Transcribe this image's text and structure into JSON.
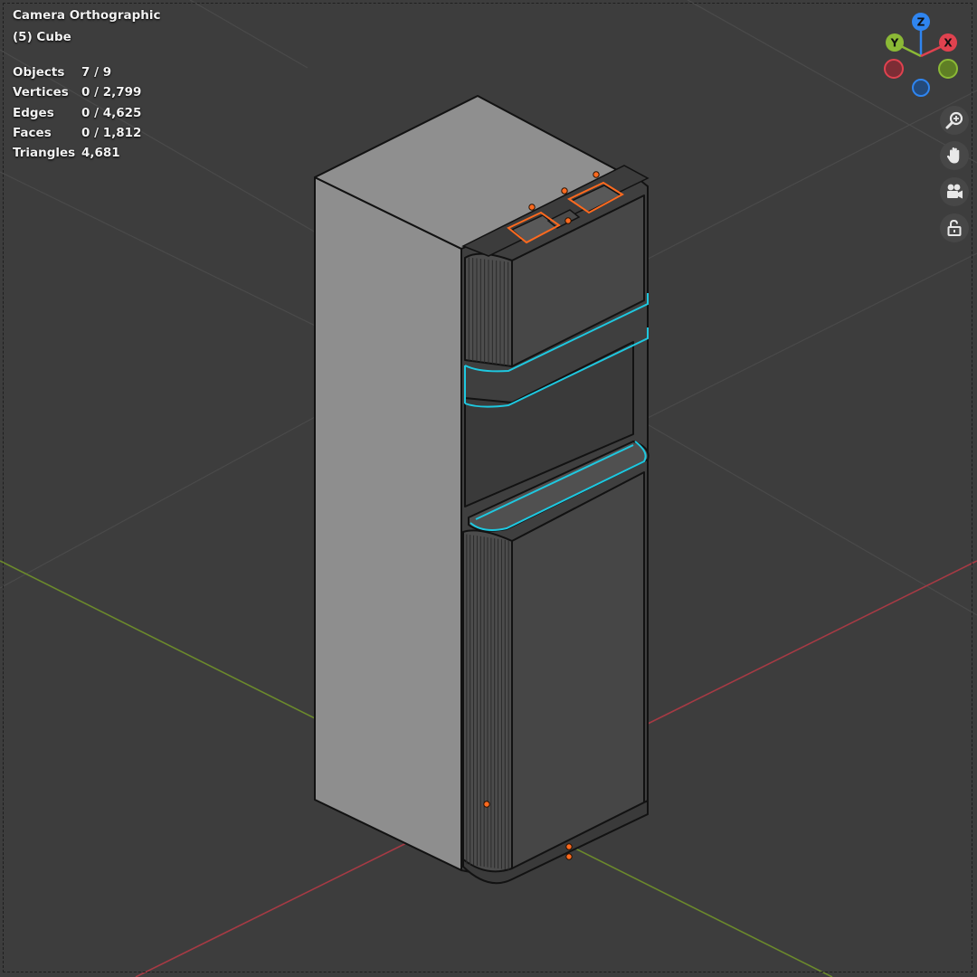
{
  "viewport": {
    "camera_title": "Camera Orthographic",
    "active_object": "(5) Cube",
    "stats": [
      {
        "label": "Objects",
        "value": "7 / 9"
      },
      {
        "label": "Vertices",
        "value": "0 / 2,799"
      },
      {
        "label": "Edges",
        "value": "0 / 4,625"
      },
      {
        "label": "Faces",
        "value": "0 / 1,812"
      },
      {
        "label": "Triangles",
        "value": "4,681"
      }
    ]
  },
  "gizmo": {
    "z_label": "Z",
    "y_label": "Y",
    "x_label": "X",
    "colors": {
      "x": "#e0424f",
      "y": "#8bb936",
      "z": "#2f85f0"
    }
  },
  "nav_buttons": [
    {
      "icon": "zoom-icon"
    },
    {
      "icon": "hand-pan-icon"
    },
    {
      "icon": "camera-icon"
    },
    {
      "icon": "lock-icon"
    }
  ],
  "colors": {
    "background": "#3d3d3d",
    "x_axis": "#a63a44",
    "y_axis": "#6c8a2c",
    "selection_outline": "#ff6a1f",
    "active_outline": "#1ec8e0"
  }
}
